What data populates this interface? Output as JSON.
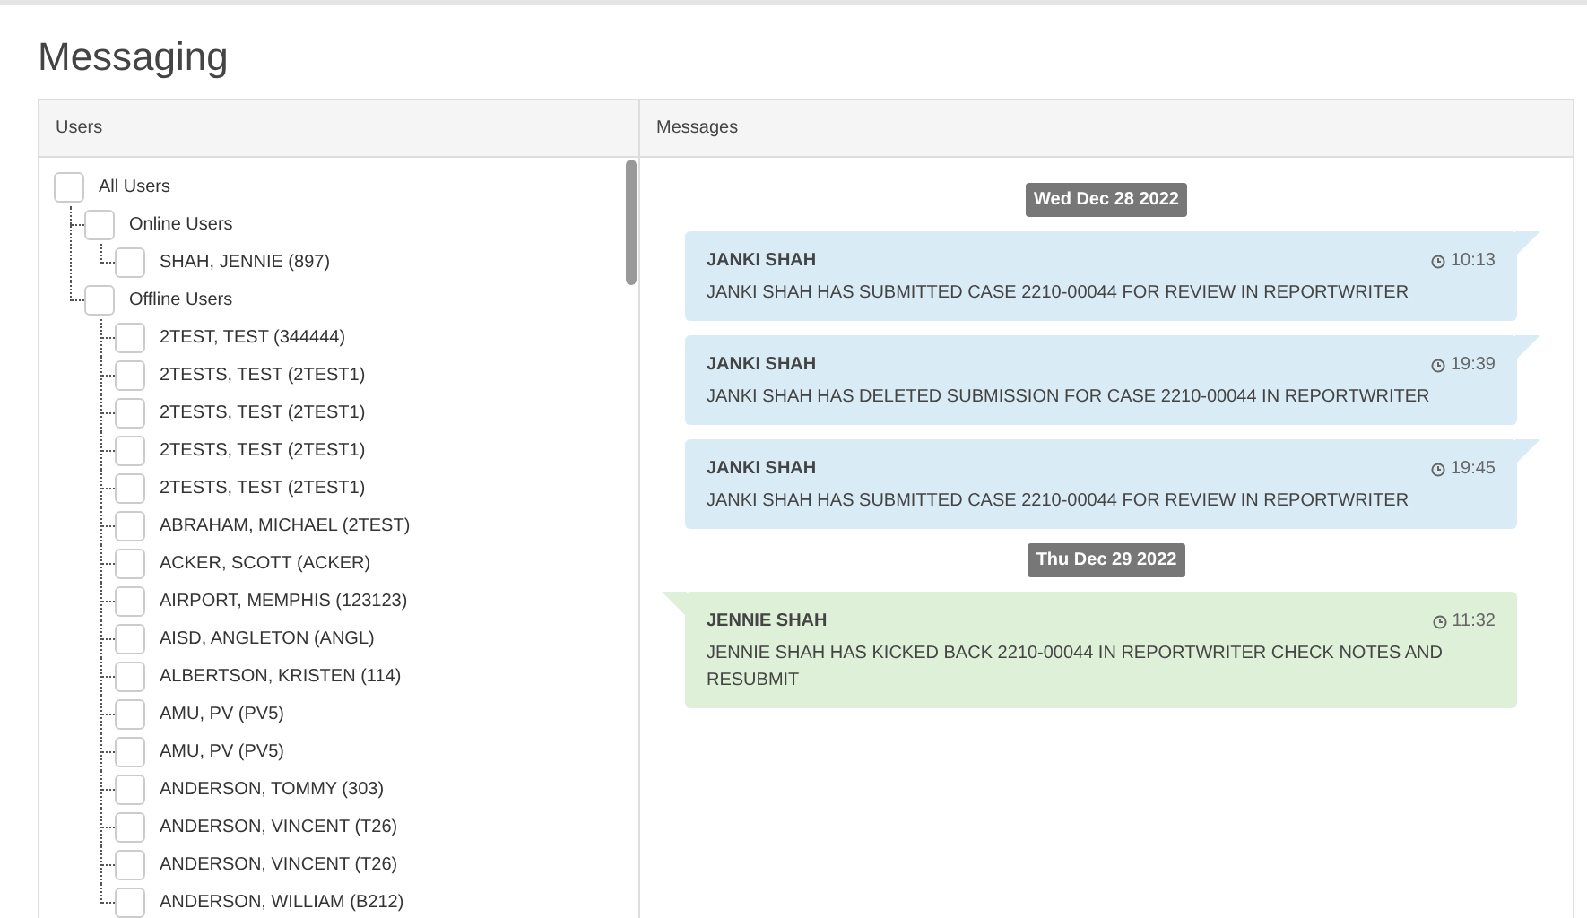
{
  "page_title": "Messaging",
  "users_panel": {
    "header": "Users",
    "tree": [
      {
        "label": "All Users",
        "checked": false,
        "children": [
          {
            "label": "Online Users",
            "checked": false,
            "children": [
              {
                "label": "SHAH, JENNIE (897)",
                "checked": false
              }
            ]
          },
          {
            "label": "Offline Users",
            "checked": false,
            "children": [
              {
                "label": "2TEST, TEST (344444)",
                "checked": false
              },
              {
                "label": "2TESTS, TEST (2TEST1)",
                "checked": false
              },
              {
                "label": "2TESTS, TEST (2TEST1)",
                "checked": false
              },
              {
                "label": "2TESTS, TEST (2TEST1)",
                "checked": false
              },
              {
                "label": "2TESTS, TEST (2TEST1)",
                "checked": false
              },
              {
                "label": "ABRAHAM, MICHAEL (2TEST)",
                "checked": false
              },
              {
                "label": "ACKER, SCOTT (ACKER)",
                "checked": false
              },
              {
                "label": "AIRPORT, MEMPHIS (123123)",
                "checked": false
              },
              {
                "label": "AISD, ANGLETON (ANGL)",
                "checked": false
              },
              {
                "label": "ALBERTSON, KRISTEN (114)",
                "checked": false
              },
              {
                "label": "AMU, PV (PV5)",
                "checked": false
              },
              {
                "label": "AMU, PV (PV5)",
                "checked": false
              },
              {
                "label": "ANDERSON, TOMMY (303)",
                "checked": false
              },
              {
                "label": "ANDERSON, VINCENT (T26)",
                "checked": false
              },
              {
                "label": "ANDERSON, VINCENT (T26)",
                "checked": false
              },
              {
                "label": "ANDERSON, WILLIAM (B212)",
                "checked": false
              }
            ]
          }
        ]
      }
    ]
  },
  "messages_panel": {
    "header": "Messages",
    "days": [
      {
        "date": "Wed Dec 28 2022",
        "messages": [
          {
            "kind": "sent",
            "sender": "JANKI SHAH",
            "time": "10:13",
            "text": "JANKI SHAH HAS SUBMITTED CASE 2210-00044 FOR REVIEW IN REPORTWRITER"
          },
          {
            "kind": "sent",
            "sender": "JANKI SHAH",
            "time": "19:39",
            "text": "JANKI SHAH HAS DELETED SUBMISSION FOR CASE 2210-00044 IN REPORTWRITER"
          },
          {
            "kind": "sent",
            "sender": "JANKI SHAH",
            "time": "19:45",
            "text": "JANKI SHAH HAS SUBMITTED CASE 2210-00044 FOR REVIEW IN REPORTWRITER"
          }
        ]
      },
      {
        "date": "Thu Dec 29 2022",
        "messages": [
          {
            "kind": "received",
            "sender": "JENNIE SHAH",
            "time": "11:32",
            "text": "JENNIE SHAH HAS KICKED BACK 2210-00044 IN REPORTWRITER CHECK NOTES AND RESUBMIT"
          }
        ]
      }
    ]
  }
}
